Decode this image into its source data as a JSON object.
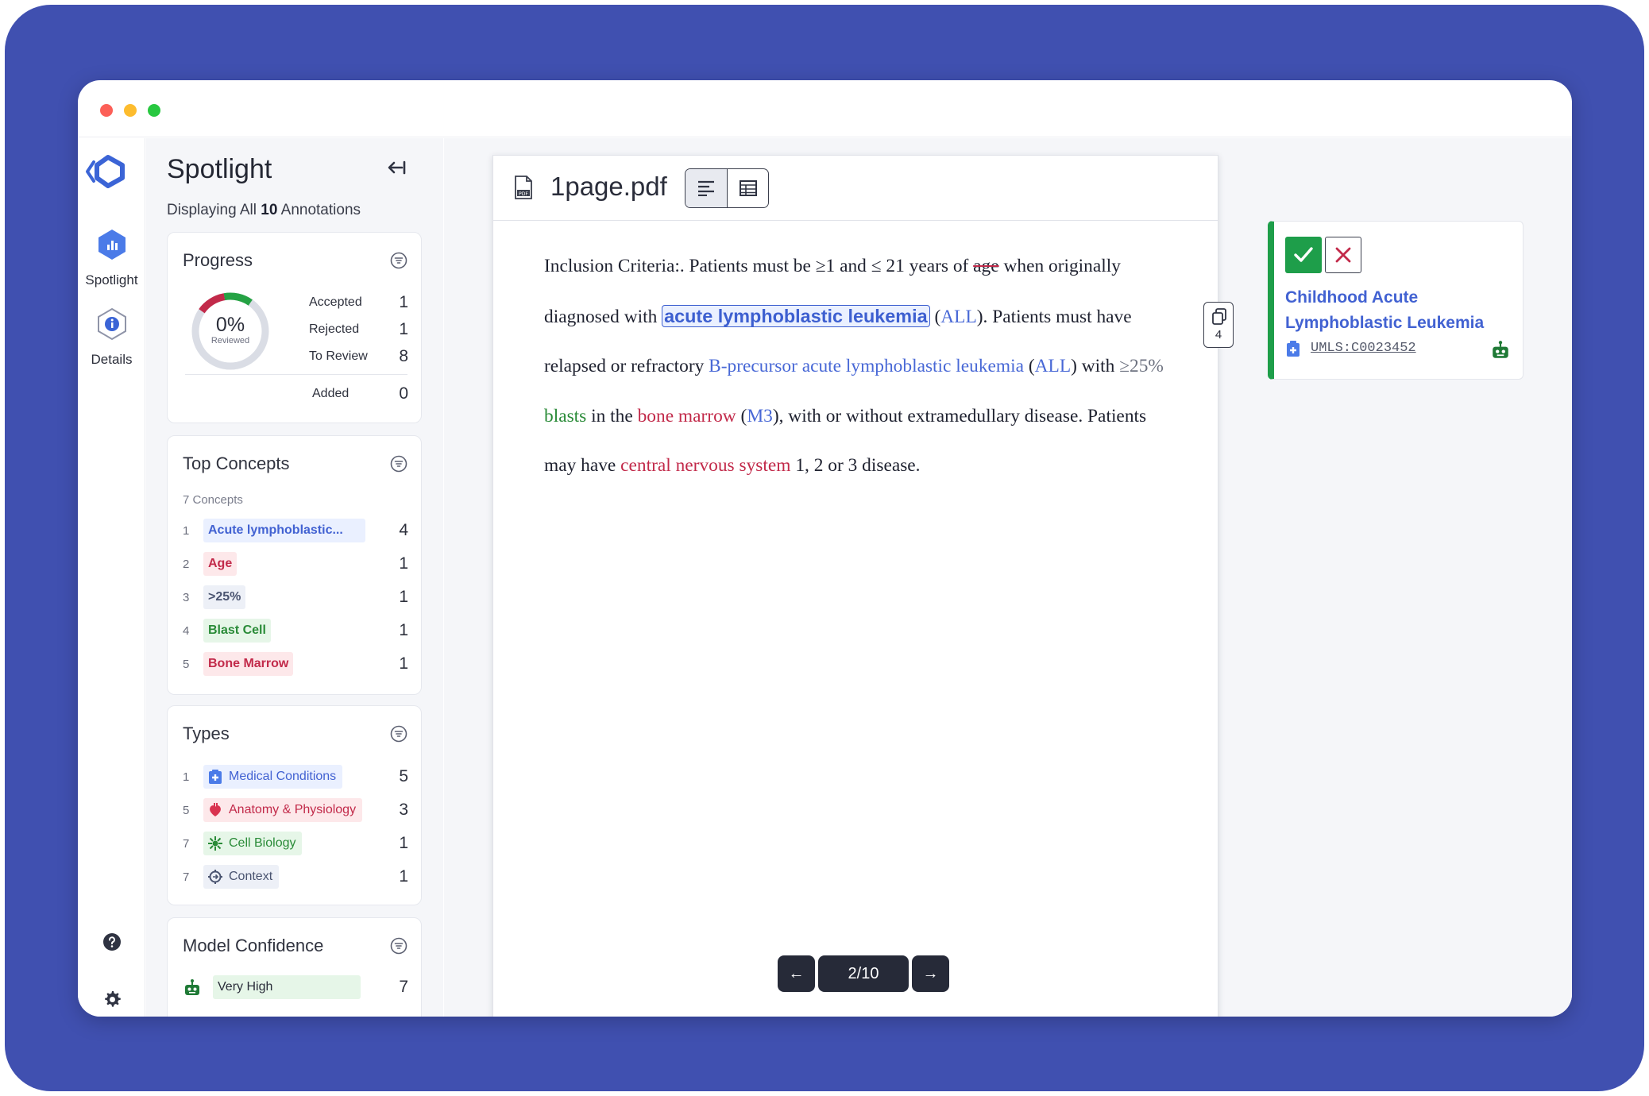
{
  "app": {
    "brand": "logo-icon"
  },
  "rail": {
    "items": [
      {
        "label": "Spotlight",
        "icon": "spotlight-icon",
        "active": true
      },
      {
        "label": "Details",
        "icon": "details-icon",
        "active": false
      }
    ],
    "bottom_icons": [
      "help-icon",
      "gear-icon"
    ]
  },
  "spotlight": {
    "title": "Spotlight",
    "subtitle_prefix": "Displaying All",
    "count": "10",
    "subtitle_suffix": "Annotations"
  },
  "progress": {
    "title": "Progress",
    "percent": "0%",
    "percent_label": "Reviewed",
    "rows": [
      {
        "label": "Accepted",
        "value": "1"
      },
      {
        "label": "Rejected",
        "value": "1"
      },
      {
        "label": "To Review",
        "value": "8"
      },
      {
        "label": "Added",
        "value": "0"
      }
    ]
  },
  "top_concepts": {
    "title": "Top Concepts",
    "count_label": "7 Concepts",
    "items": [
      {
        "rank": "1",
        "label": "Acute lymphoblastic...",
        "count": "4",
        "color": "#4262d2",
        "bg": "#eaf0ff"
      },
      {
        "rank": "2",
        "label": "Age",
        "count": "1",
        "color": "#c22a4a",
        "bg": "#fde8ea"
      },
      {
        "rank": "3",
        "label": ">25%",
        "count": "1",
        "color": "#4a5470",
        "bg": "#edf0f7"
      },
      {
        "rank": "4",
        "label": "Blast Cell",
        "count": "1",
        "color": "#2a8b38",
        "bg": "#e6f6e8"
      },
      {
        "rank": "5",
        "label": "Bone Marrow",
        "count": "1",
        "color": "#c22a4a",
        "bg": "#fde8ea"
      }
    ]
  },
  "types": {
    "title": "Types",
    "items": [
      {
        "rank": "1",
        "label": "Medical Conditions",
        "count": "5",
        "icon": "medical-conditions-icon",
        "color": "#4262d2",
        "bg": "#eaf0ff"
      },
      {
        "rank": "5",
        "label": "Anatomy & Physiology",
        "count": "3",
        "icon": "anatomy-icon",
        "color": "#c22a4a",
        "bg": "#fde8ea"
      },
      {
        "rank": "7",
        "label": "Cell Biology",
        "count": "1",
        "icon": "cell-biology-icon",
        "color": "#2a8b38",
        "bg": "#e6f6e8"
      },
      {
        "rank": "7",
        "label": "Context",
        "count": "1",
        "icon": "context-icon",
        "color": "#4a5470",
        "bg": "#edf0f7"
      }
    ]
  },
  "model_confidence": {
    "title": "Model Confidence",
    "items": [
      {
        "label": "Very High",
        "count": "7",
        "icon": "robot-icon",
        "bg": "#e6f6e8"
      }
    ]
  },
  "document": {
    "filename": "1page.pdf",
    "view_modes": [
      "text-view-icon",
      "table-view-icon"
    ],
    "paragraph": {
      "t1": "Inclusion Criteria:. Patients must be ≥1 and ≤ 21 years of ",
      "age": "age",
      "t2": " when originally diagnosed with ",
      "e1": "acute lymphoblastic leukemia",
      "t3": " (",
      "e2": "ALL",
      "t4": "). Patients must have relapsed or refractory ",
      "e3": "B-precursor acute lymphoblastic leukemia",
      "t5": " (",
      "e4": "ALL",
      "t6": ") with ",
      "e5": "≥25%",
      "t7": " ",
      "e6": "blasts",
      "t8": " in the ",
      "e7": "bone marrow",
      "t9": " (",
      "e8": "M3",
      "t10": "), with or without extramedullary disease. Patients may have ",
      "e9": "central nervous system",
      "t11": " 1, 2 or 3 disease."
    },
    "copy_count": "4",
    "pager": {
      "current": "2/10",
      "prev": "←",
      "next": "→"
    }
  },
  "annotation": {
    "name": "Childhood Acute Lymphoblastic Leukemia",
    "code": "UMLS:C0023452",
    "status": "accepted",
    "accept_color": "#1e9e4a",
    "reject_color": "#c22a4a"
  },
  "colors": {
    "frame": "#4050b0",
    "entity_blue": "#4868d6",
    "entity_red": "#c22a4a",
    "entity_green": "#2a8b38"
  }
}
